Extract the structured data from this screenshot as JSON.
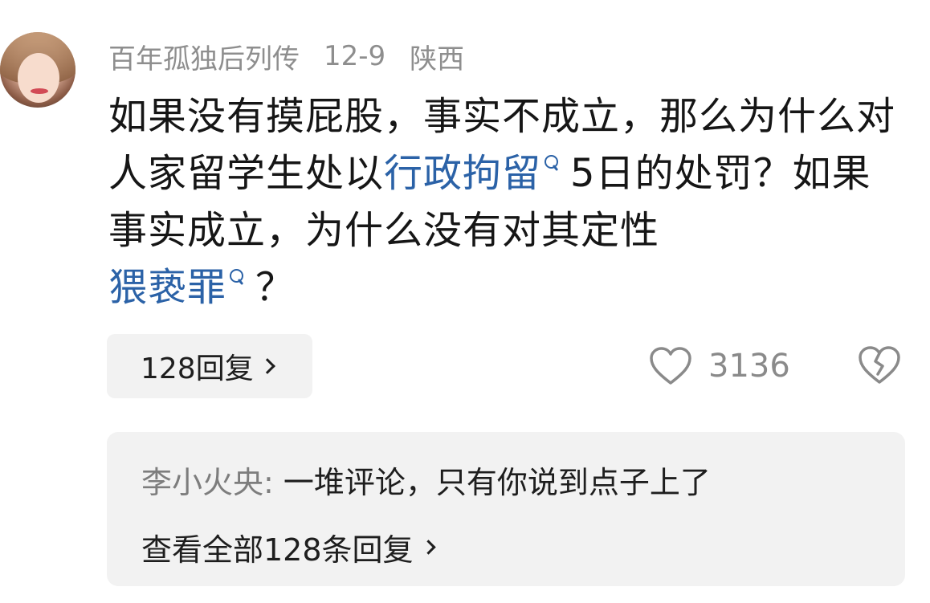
{
  "comment": {
    "author": "百年孤独后列传",
    "date": "12-9",
    "location": "陕西",
    "text_part1": "如果没有摸屁股，事实不成立，那么为什么对人家留学生处以",
    "link1": "行政拘留",
    "text_part2": "5日的处罚？如果事实成立，为什么没有对其定性",
    "link2": "猥亵罪",
    "text_part3": "？",
    "reply_button_label": "128回复",
    "like_count": "3136",
    "colors": {
      "link": "#2b62a7",
      "meta": "#8e8e8e",
      "panel": "#f2f2f2"
    }
  },
  "replies": {
    "preview_author": "李小火央:",
    "preview_text": " 一堆评论，只有你说到点子上了",
    "view_all_label": "查看全部128条回复"
  },
  "icons": {
    "avatar": "avatar-photo",
    "search": "search-icon",
    "like": "heart-outline-icon",
    "dislike": "broken-heart-icon",
    "chevron": "chevron-right-icon"
  }
}
